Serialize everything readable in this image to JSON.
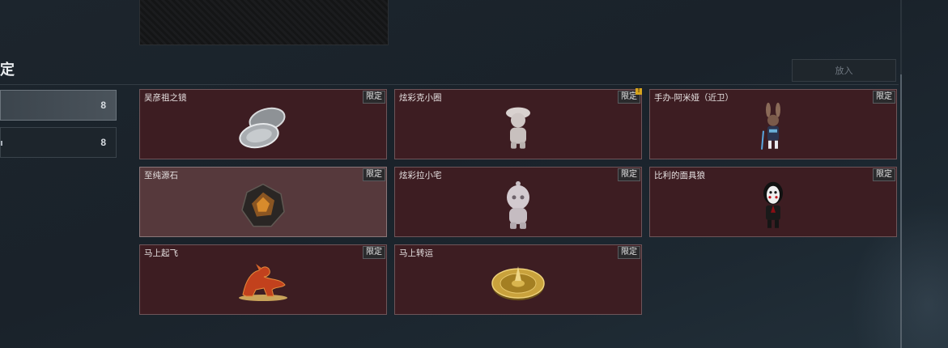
{
  "section": {
    "title": "定"
  },
  "put_button": {
    "label": "放入"
  },
  "sidebar": {
    "tabs": [
      {
        "count": "8",
        "active": true
      },
      {
        "count": "8",
        "active": false
      }
    ]
  },
  "items": [
    {
      "name": "吴彦祖之镜",
      "badge": "限定",
      "icon": "mirror-icon"
    },
    {
      "name": "炫彩克小圈",
      "badge": "限定",
      "icon": "figurine-icon",
      "alert": "!"
    },
    {
      "name": "手办-阿米娅（近卫）",
      "badge": "限定",
      "icon": "amiya-figure-icon"
    },
    {
      "name": "至纯源石",
      "badge": "限定",
      "icon": "originium-icon"
    },
    {
      "name": "炫彩拉小宅",
      "badge": "限定",
      "icon": "plush-figure-icon"
    },
    {
      "name": "比利的面具狼",
      "badge": "限定",
      "icon": "puppet-mask-icon"
    },
    {
      "name": "马上起飞",
      "badge": "限定",
      "icon": "horse-statue-icon"
    },
    {
      "name": "马上转运",
      "badge": "限定",
      "icon": "fortune-wheel-icon"
    }
  ]
}
